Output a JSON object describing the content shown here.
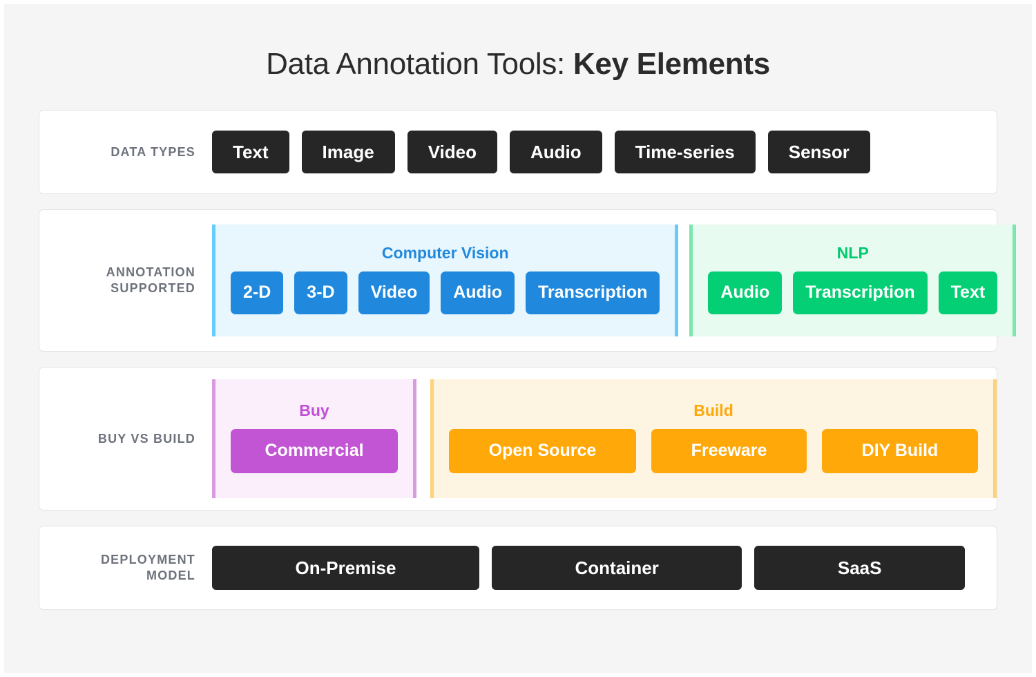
{
  "title": {
    "regular": "Data Annotation Tools: ",
    "bold": "Key Elements"
  },
  "colors": {
    "page_background": "#f5f5f5",
    "card_background": "#ffffff",
    "card_border": "#e2e2e2",
    "label_text": "#6e727c",
    "chip_dark": "#262626",
    "computer_vision": "#2189dd",
    "computer_vision_panel": "#e8f6fd",
    "computer_vision_bar": "#66ccfa",
    "nlp": "#05cf74",
    "nlp_panel": "#e7fbf0",
    "nlp_bar": "#79e7ae",
    "buy": "#c155d4",
    "buy_panel": "#faeffb",
    "buy_bar": "#d89be0",
    "build": "#ffa809",
    "build_panel": "#fdf4e1",
    "build_bar": "#ffd27a"
  },
  "rows": {
    "data_types": {
      "label": "DATA TYPES",
      "chips": [
        "Text",
        "Image",
        "Video",
        "Audio",
        "Time-series",
        "Sensor"
      ]
    },
    "annotation_supported": {
      "label": "ANNOTATION SUPPORTED",
      "label_line1": "ANNOTATION",
      "label_line2": "SUPPORTED",
      "groups": [
        {
          "title": "Computer Vision",
          "chips": [
            "2-D",
            "3-D",
            "Video",
            "Audio",
            "Transcription"
          ]
        },
        {
          "title": "NLP",
          "chips": [
            "Audio",
            "Transcription",
            "Text"
          ]
        }
      ]
    },
    "buy_vs_build": {
      "label": "BUY VS BUILD",
      "groups": [
        {
          "title": "Buy",
          "chips": [
            "Commercial"
          ]
        },
        {
          "title": "Build",
          "chips": [
            "Open Source",
            "Freeware",
            "DIY Build"
          ]
        }
      ]
    },
    "deployment_model": {
      "label": "DEPLOYMENT MODEL",
      "label_line1": "DEPLOYMENT",
      "label_line2": "MODEL",
      "chips": [
        "On-Premise",
        "Container",
        "SaaS"
      ]
    }
  }
}
